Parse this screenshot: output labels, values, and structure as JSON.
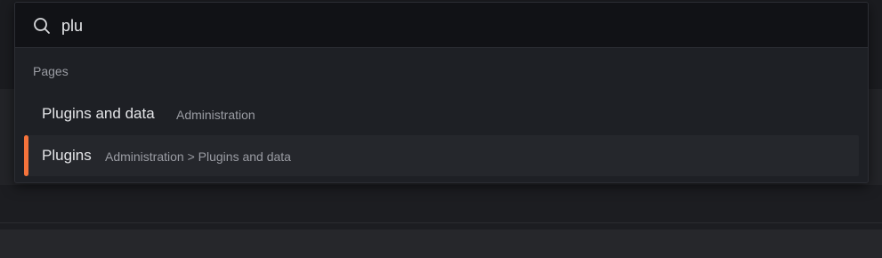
{
  "search": {
    "value": "plu",
    "icon": "search-icon"
  },
  "section": {
    "heading": "Pages"
  },
  "results": [
    {
      "title": "Plugins and data",
      "path": "Administration",
      "selected": false
    },
    {
      "title": "Plugins",
      "path": "Administration > Plugins and data",
      "selected": true
    }
  ],
  "colors": {
    "accent": "#f5733b",
    "palette_bg": "#1e2025",
    "search_bg": "#111216",
    "selected_row_bg": "#25272c",
    "text_primary": "#e4e5e8",
    "text_secondary": "#9a9ca3"
  }
}
